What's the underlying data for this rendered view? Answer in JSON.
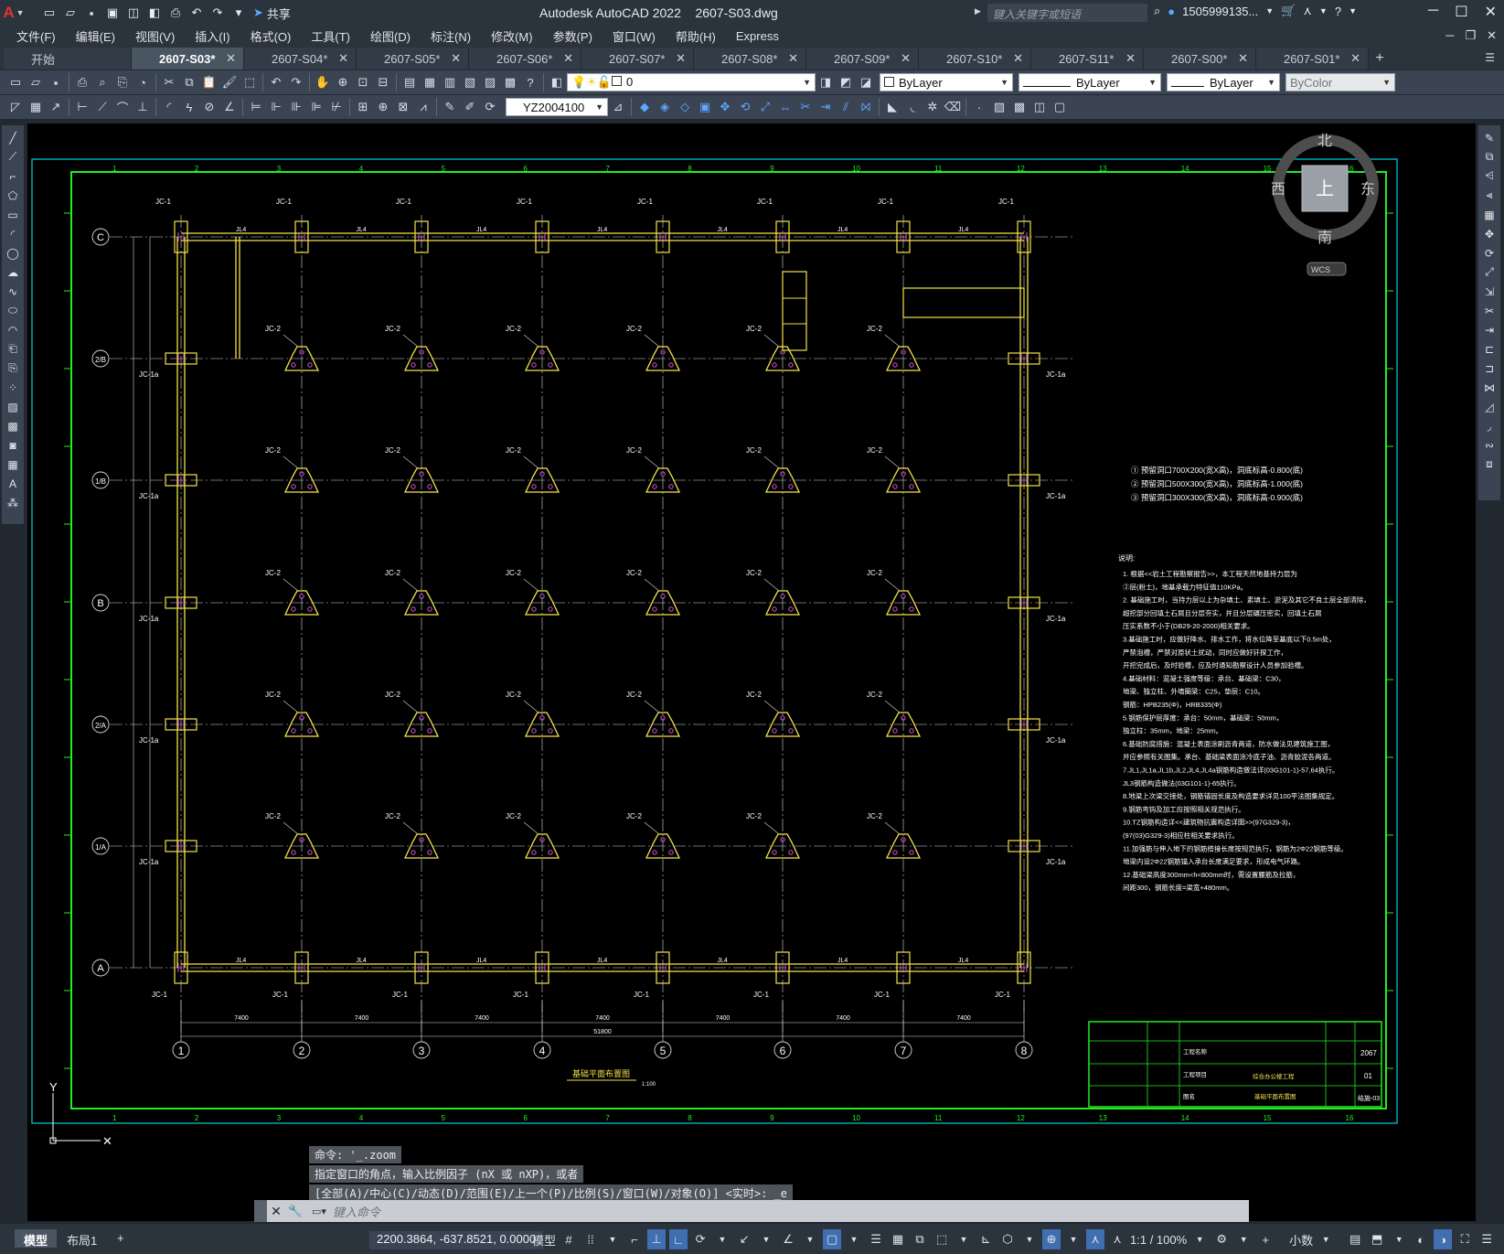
{
  "app": {
    "logo": "A",
    "title": "Autodesk AutoCAD 2022",
    "file": "2607-S03.dwg",
    "share": "共享",
    "search_placeholder": "键入关键字或短语",
    "user": "1505999135...",
    "help": "?"
  },
  "menu": [
    "文件(F)",
    "编辑(E)",
    "视图(V)",
    "插入(I)",
    "格式(O)",
    "工具(T)",
    "绘图(D)",
    "标注(N)",
    "修改(M)",
    "参数(P)",
    "窗口(W)",
    "帮助(H)",
    "Express"
  ],
  "tabs": [
    {
      "label": "开始",
      "active": false,
      "close": false
    },
    {
      "label": "2607-S03*",
      "active": true,
      "close": true
    },
    {
      "label": "2607-S04*",
      "active": false,
      "close": true
    },
    {
      "label": "2607-S05*",
      "active": false,
      "close": true
    },
    {
      "label": "2607-S06*",
      "active": false,
      "close": true
    },
    {
      "label": "2607-S07*",
      "active": false,
      "close": true
    },
    {
      "label": "2607-S08*",
      "active": false,
      "close": true
    },
    {
      "label": "2607-S09*",
      "active": false,
      "close": true
    },
    {
      "label": "2607-S10*",
      "active": false,
      "close": true
    },
    {
      "label": "2607-S11*",
      "active": false,
      "close": true
    },
    {
      "label": "2607-S00*",
      "active": false,
      "close": true
    },
    {
      "label": "2607-S01*",
      "active": false,
      "close": true
    }
  ],
  "toolbar": {
    "layer_value": "0",
    "color_value": "ByLayer",
    "linetype_value": "ByLayer",
    "lineweight_value": "ByLayer",
    "plotstyle_value": "ByColor",
    "textstyle_value": "YZ2004100"
  },
  "viewcube": {
    "north": "北",
    "south": "南",
    "east": "东",
    "west": "西",
    "face": "上",
    "wcs": "WCS"
  },
  "drawing": {
    "axes_x": [
      "1",
      "2",
      "3",
      "4",
      "5",
      "6",
      "7",
      "8"
    ],
    "axes_y": [
      "C",
      "2/B",
      "1/B",
      "B",
      "2/A",
      "1/A",
      "A"
    ],
    "span_dims": [
      "7400",
      "7400",
      "7400",
      "7400",
      "7400",
      "7400",
      "7400"
    ],
    "total_dim": "51800",
    "label_jc1": "JC-1",
    "label_jc1a": "JC-1a",
    "label_jc2": "JC-2",
    "label_jl4": "JL4",
    "drawing_title": "基础平面布置图",
    "drawing_scale": "1:100",
    "legend": [
      "① 预留洞口700X200(宽X高)，洞底标高-0.800(底)",
      "② 预留洞口500X300(宽X高)，洞底标高-1.000(底)",
      "③ 预留洞口300X300(宽X高)，洞底标高-0.900(底)"
    ],
    "notes_title": "说明:",
    "notes": [
      "1. 根据<<岩土工程勘察报告>>，本工程天然地基持力层为",
      "   ②层(粉土)，地基承载力特征值110KPa。",
      "2. 基础施工时，当持力层以上为杂填土、素填土、淤泥及其它不良土层全部清除，",
      "   超挖部分回填土石屑且分层夯实，并且分层碾压密实，回填土石屑",
      "   压实系数不小于(DB29-20-2000)相关要求。",
      "3.基础施工时，应做好降水、排水工作，将水位降至基底以下0.5m处，",
      "   严禁泡槽，严禁对原状土扰动，同时应做好钎探工作，",
      "   开挖完成后，及时验槽，应及时通知勘察设计人员参加验槽。",
      "4.基础材料：混凝土强度等级：承台、基础梁：C30，",
      "   地梁、独立柱、外墙圈梁：C25，垫层：C10。",
      "   钢筋：HPB235(Φ)，HRB335(Φ)",
      "5.钢筋保护层厚度：承台：50mm，基础梁：50mm，",
      "   独立柱：35mm，地梁：25mm。",
      "6.基础防腐措施：混凝土表面涂刷沥青两道，防水做法见建筑施工图，",
      "   并应参照有关图集。承台、基础梁表面涂冷底子油、沥青胶泥各两道。",
      "7.JL1,JL1a,JL1b,JL2,JL4,JL4a钢筋构造做法详(03G101-1)-57,64执行。",
      "   JL3钢筋构造做法(03G101-1)-65执行。",
      "8.地梁上次梁交接处，钢筋锚固长度及构造要求详见100平法图集规定。",
      "9.钢筋弯钩及加工应按照相关规范执行。",
      "10.TZ钢筋构造详<<建筑物抗震构造详图>>(97G329-3)，",
      "   (97(03)G329-3)相应柱相关要求执行。",
      "11.加强筋与伸入地下的钢筋搭接长度按规范执行，钢筋为2Φ22钢筋等级。",
      "   地梁内设2Φ22钢筋锚入承台长度满足要求，形成电气环路。",
      "12.基础梁高度300mm<h<800mm时，需设置腰筋及拉筋，",
      "   间距300，钢筋长度=梁宽+480mm。"
    ],
    "title_block": {
      "num": "2067",
      "page": "01",
      "code": "结施-03",
      "project_label": "工程名称",
      "item_label": "工程项目",
      "figure_label": "图名",
      "figure_name": "基础平面布置图",
      "project_name": "综合办公楼工程"
    }
  },
  "command": {
    "hist1": "命令: '_.zoom",
    "hist2": "指定窗口的角点，输入比例因子 (nX 或 nXP)，或者",
    "hist3": "[全部(A)/中心(C)/动态(D)/范围(E)/上一个(P)/比例(S)/窗口(W)/对象(O)] <实时>: _e",
    "placeholder": "键入命令"
  },
  "status": {
    "model_tab": "模型",
    "layout_tab": "布局1",
    "coords": "2200.3864, -637.8521, 0.0000",
    "model_label": "模型",
    "scale": "1:1 / 100%",
    "units": "小数"
  },
  "colors": {
    "canvas": "#000000",
    "frame_cyan": "#00d4dc",
    "border_green": "#22ee22",
    "grid_white": "#d8d8d8",
    "wall_yellow": "#f3e24a",
    "footing_yellow": "#f3e24a",
    "bolt_magenta": "#d455d4",
    "note_text": "#ffffff",
    "ui_dark": "#2b333d",
    "ui_toolbar": "#3b4453"
  }
}
